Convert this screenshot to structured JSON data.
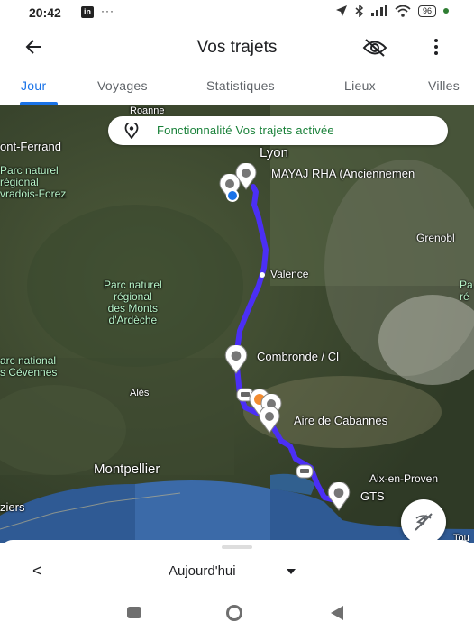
{
  "status_bar": {
    "time": "20:42",
    "app_badge": "in",
    "dots": "···",
    "battery": "96"
  },
  "app_bar": {
    "title": "Vos trajets"
  },
  "tabs": [
    {
      "label": "Jour"
    },
    {
      "label": "Voyages"
    },
    {
      "label": "Statistiques"
    },
    {
      "label": "Lieux"
    },
    {
      "label": "Villes"
    }
  ],
  "banner": {
    "text": "Fonctionnalité Vos trajets activée"
  },
  "map_labels": {
    "roanne": "Roanne",
    "clermont": "ont-Ferrand",
    "livradois": "Parc naturel\nrégional\nvradois-Forez",
    "lyon": "Lyon",
    "mayaj": "MAYAJ RHA (Anciennemen",
    "grenoble": "Grenobl",
    "valence": "Valence",
    "ardeche": "Parc naturel\nrégional\ndes Monts\nd'Ardèche",
    "pa": "Pa\nré",
    "combronde": "Combronde / Cl",
    "cevennes": "arc national\ns Cévennes",
    "ales": "Alès",
    "aire": "Aire de Cabannes",
    "montpellier": "Montpellier",
    "aix": "Aix-en-Proven",
    "gts": "GTS",
    "ziers": "ziers",
    "tou": "Tou"
  },
  "bottom_sheet": {
    "prev": "<",
    "date": "Aujourd'hui"
  },
  "colors": {
    "accent": "#1a73e8",
    "route": "#4b2ff5",
    "banner_text": "#188038"
  }
}
